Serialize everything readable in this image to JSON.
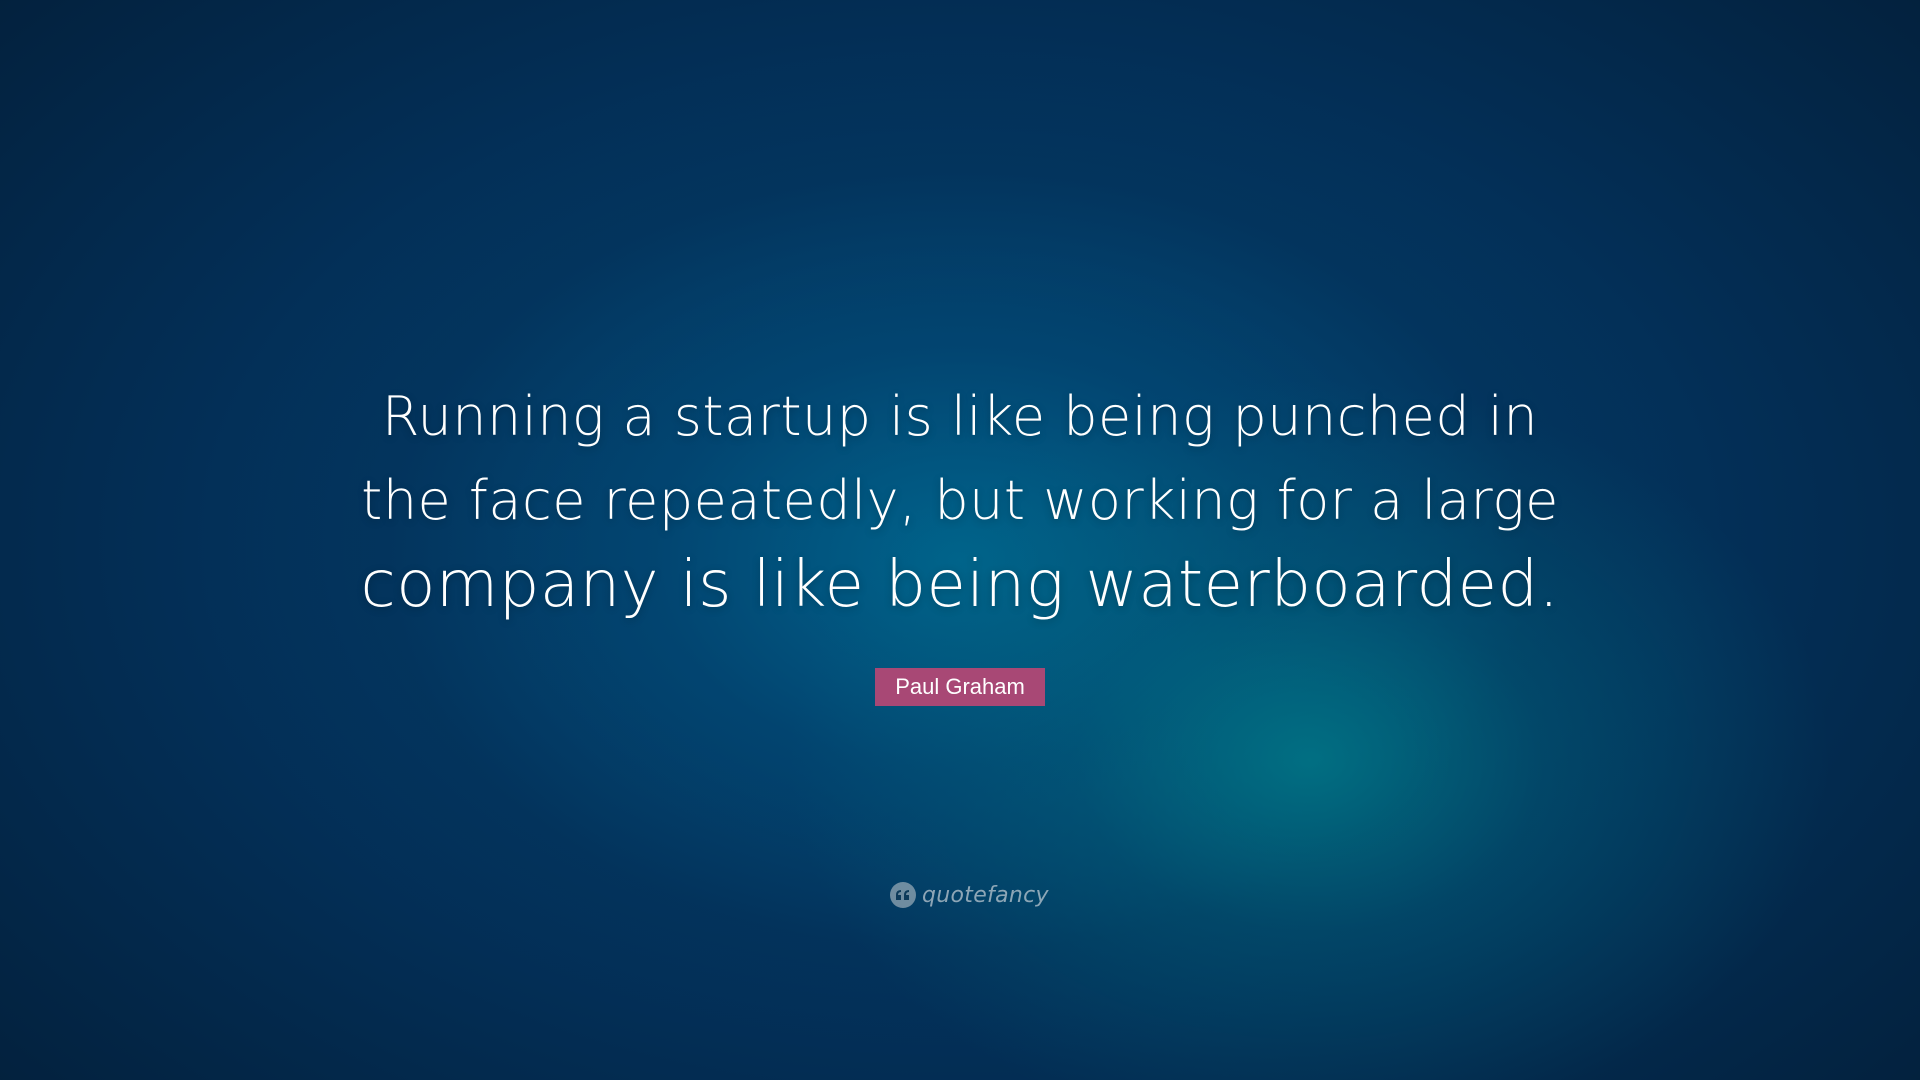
{
  "quote": {
    "lines": [
      "Running a startup is like being punched in",
      "the face repeatedly, but working for a large",
      "company is like being waterboarded."
    ]
  },
  "author": {
    "name": "Paul Graham",
    "badge_color": "#a84875"
  },
  "brand": {
    "name": "quotefancy",
    "icon": "quote-marks-icon"
  },
  "colors": {
    "background_dark": "#031e38",
    "background_glow": "#00808c",
    "text": "#ffffff"
  }
}
